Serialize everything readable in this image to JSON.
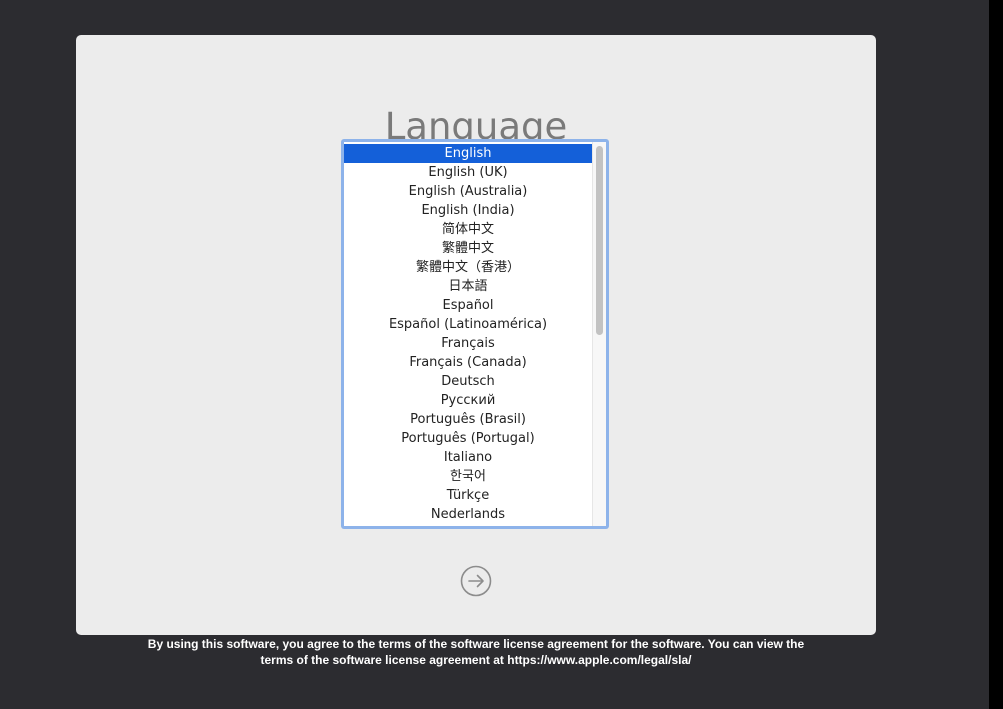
{
  "title": "Language",
  "languages": [
    "English",
    "English (UK)",
    "English (Australia)",
    "English (India)",
    "简体中文",
    "繁體中文",
    "繁體中文（香港）",
    "日本語",
    "Español",
    "Español (Latinoamérica)",
    "Français",
    "Français (Canada)",
    "Deutsch",
    "Русский",
    "Português (Brasil)",
    "Português (Portugal)",
    "Italiano",
    "한국어",
    "Türkçe",
    "Nederlands"
  ],
  "selected_language": "English",
  "continue_icon": "arrow-right-circle-icon",
  "license": {
    "line1": "By using this software, you agree to the terms of the software license agreement for the software. You can view the",
    "line2": "terms of the software license agreement at https://www.apple.com/legal/sla/"
  },
  "colors": {
    "background": "#2c2c30",
    "panel": "#ececec",
    "selection": "#1460d9",
    "focus_ring": "#8db3ea",
    "title": "#7a7a7a"
  }
}
